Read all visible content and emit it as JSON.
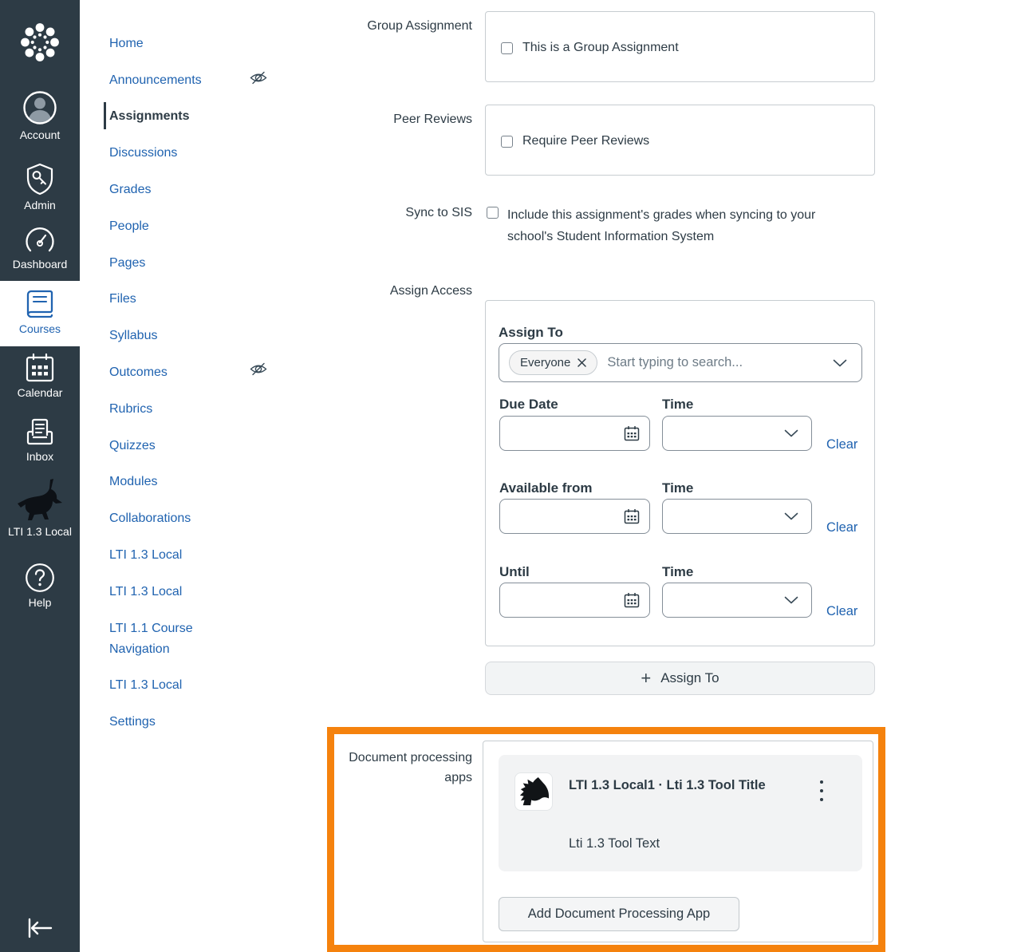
{
  "colors": {
    "sidebar_bg": "#2D3B45",
    "link_blue": "#2063B0",
    "text_dark": "#2D3B45",
    "highlight_orange": "#F5820D",
    "box_border": "#C7CDD1"
  },
  "global_nav": {
    "items": [
      {
        "label": "Account",
        "icon": "avatar-icon"
      },
      {
        "label": "Admin",
        "icon": "shield-key-icon"
      },
      {
        "label": "Dashboard",
        "icon": "gauge-icon"
      },
      {
        "label": "Courses",
        "icon": "book-icon",
        "active": true
      },
      {
        "label": "Calendar",
        "icon": "calendar-icon"
      },
      {
        "label": "Inbox",
        "icon": "inbox-icon"
      },
      {
        "label": "LTI 1.3 Local",
        "icon": "unicorn-icon"
      },
      {
        "label": "Help",
        "icon": "question-icon"
      }
    ]
  },
  "course_nav": {
    "items": [
      "Home",
      "Announcements",
      "Assignments",
      "Discussions",
      "Grades",
      "People",
      "Pages",
      "Files",
      "Syllabus",
      "Outcomes",
      "Rubrics",
      "Quizzes",
      "Modules",
      "Collaborations",
      "LTI 1.3 Local",
      "LTI 1.3 Local",
      "LTI 1.1 Course Navigation",
      "LTI 1.3 Local",
      "Settings"
    ],
    "active_item": "Assignments",
    "hidden_items": [
      "Announcements",
      "Outcomes"
    ]
  },
  "form": {
    "group_assignment": {
      "label": "Group Assignment",
      "checkbox_label": "This is a Group Assignment",
      "checked": false
    },
    "peer_reviews": {
      "label": "Peer Reviews",
      "checkbox_label": "Require Peer Reviews",
      "checked": false
    },
    "sync_to_sis": {
      "label": "Sync to SIS",
      "checkbox_label": "Include this assignment's grades when syncing to your school's Student Information System",
      "checked": false
    },
    "assign_access": {
      "label": "Assign Access",
      "assign_to_label": "Assign To",
      "selected_tag": "Everyone",
      "search_placeholder": "Start typing to search...",
      "rows": [
        {
          "date_label": "Due Date",
          "time_label": "Time",
          "clear_label": "Clear",
          "date_value": "",
          "time_value": ""
        },
        {
          "date_label": "Available from",
          "time_label": "Time",
          "clear_label": "Clear",
          "date_value": "",
          "time_value": ""
        },
        {
          "date_label": "Until",
          "time_label": "Time",
          "clear_label": "Clear",
          "date_value": "",
          "time_value": ""
        }
      ],
      "add_button_label": "Assign To"
    },
    "document_processing": {
      "label": "Document processing apps",
      "app_title": "LTI 1.3 Local1 · Lti 1.3 Tool Title",
      "app_text": "Lti 1.3 Tool Text",
      "add_button_label": "Add Document Processing App"
    }
  }
}
